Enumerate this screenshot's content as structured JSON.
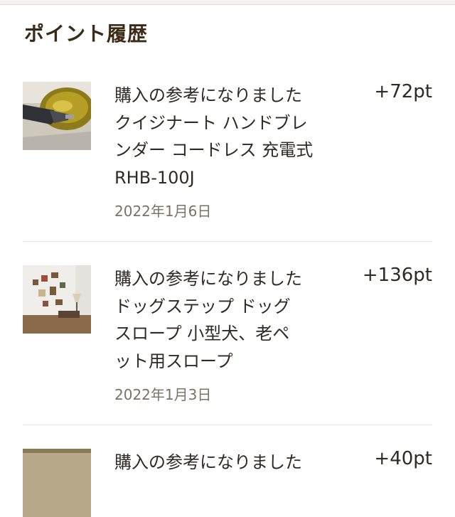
{
  "header": {
    "title": "ポイント履歴"
  },
  "history": [
    {
      "lines": [
        "購入の参考になりました",
        "クイジナート ハンドブレ",
        "ンダー コードレス 充電式",
        "RHB-100J"
      ],
      "points": "+72pt",
      "date": "2022年1月6日",
      "thumbnail": "hand-blender-photo"
    },
    {
      "lines": [
        "購入の参考になりました",
        "ドッグステップ ドッグ",
        "スロープ 小型犬、老ペ",
        "ット用スロープ"
      ],
      "points": "+136pt",
      "date": "2022年1月3日",
      "thumbnail": "living-room-photo"
    },
    {
      "lines": [
        "購入の参考になりました"
      ],
      "points": "+40pt",
      "thumbnail": "product-photo"
    }
  ]
}
